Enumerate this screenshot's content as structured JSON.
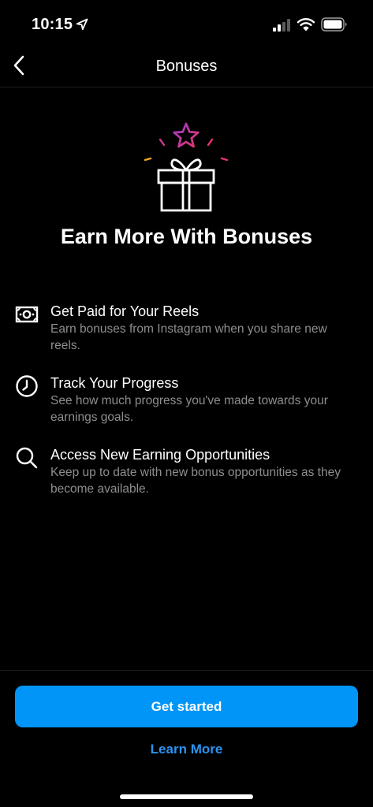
{
  "status_bar": {
    "time": "10:15",
    "location_icon": "location-arrow-icon",
    "signal_icon": "cellular-signal-icon",
    "wifi_icon": "wifi-icon",
    "battery_icon": "battery-icon"
  },
  "nav": {
    "title": "Bonuses",
    "back_icon": "chevron-left-icon"
  },
  "hero": {
    "icon": "gift-star-icon",
    "title": "Earn More With Bonuses"
  },
  "features": [
    {
      "icon": "money-icon",
      "title": "Get Paid for Your Reels",
      "description": "Earn bonuses from Instagram when you share new reels."
    },
    {
      "icon": "clock-icon",
      "title": "Track Your Progress",
      "description": "See how much progress you've made towards your earnings goals."
    },
    {
      "icon": "search-icon",
      "title": "Access New Earning Opportunities",
      "description": "Keep up to date with new bonus opportunities as they become available."
    }
  ],
  "actions": {
    "primary_label": "Get started",
    "secondary_label": "Learn More"
  },
  "colors": {
    "background": "#000000",
    "primary_button": "#0095f6",
    "link": "#2a93f0",
    "secondary_text": "#8e8e8e",
    "star_gradient_start": "#9b3cc8",
    "star_gradient_end": "#e6336b"
  }
}
